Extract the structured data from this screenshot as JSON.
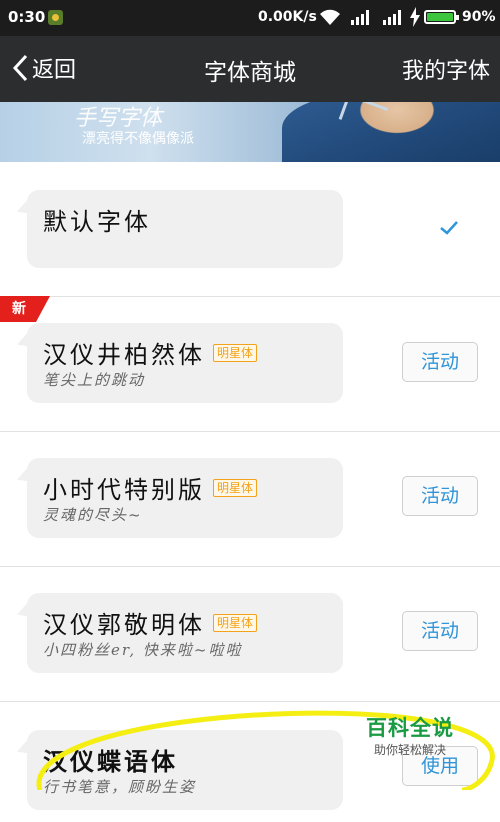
{
  "status_bar": {
    "time": "0:30",
    "network_speed": "0.00K/s",
    "battery_percent": "90%",
    "battery_level": 0.9
  },
  "nav": {
    "back_label": "返回",
    "title": "字体商城",
    "my_fonts_label": "我的字体"
  },
  "banner": {
    "brand_text": "手写字体",
    "slogan": "漂亮得不像偶像派"
  },
  "fonts": [
    {
      "name": "默认字体",
      "subtitle": "",
      "tag": "",
      "action": "",
      "selected": true,
      "is_new": false
    },
    {
      "name": "汉仪井柏然体",
      "subtitle": "笔尖上的跳动",
      "tag": "明星体",
      "action": "活动",
      "selected": false,
      "is_new": true
    },
    {
      "name": "小时代特别版",
      "subtitle": "灵魂的尽头~",
      "tag": "明星体",
      "action": "活动",
      "selected": false,
      "is_new": false
    },
    {
      "name": "汉仪郭敬明体",
      "subtitle": "小四粉丝er, 快来啦~啦啦",
      "tag": "明星体",
      "action": "活动",
      "selected": false,
      "is_new": false
    },
    {
      "name": "汉仪蝶语体",
      "subtitle": "行书笔意，顾盼生姿",
      "tag": "",
      "action": "使用",
      "selected": false,
      "is_new": false
    }
  ],
  "new_badge_label": "新",
  "watermark": {
    "title": "百科全说",
    "subtitle": "助你轻松解决"
  },
  "colors": {
    "accent": "#2f94d8",
    "tag": "#f3a21b",
    "new_badge": "#e4201c",
    "highlight": "#f5ee12"
  }
}
